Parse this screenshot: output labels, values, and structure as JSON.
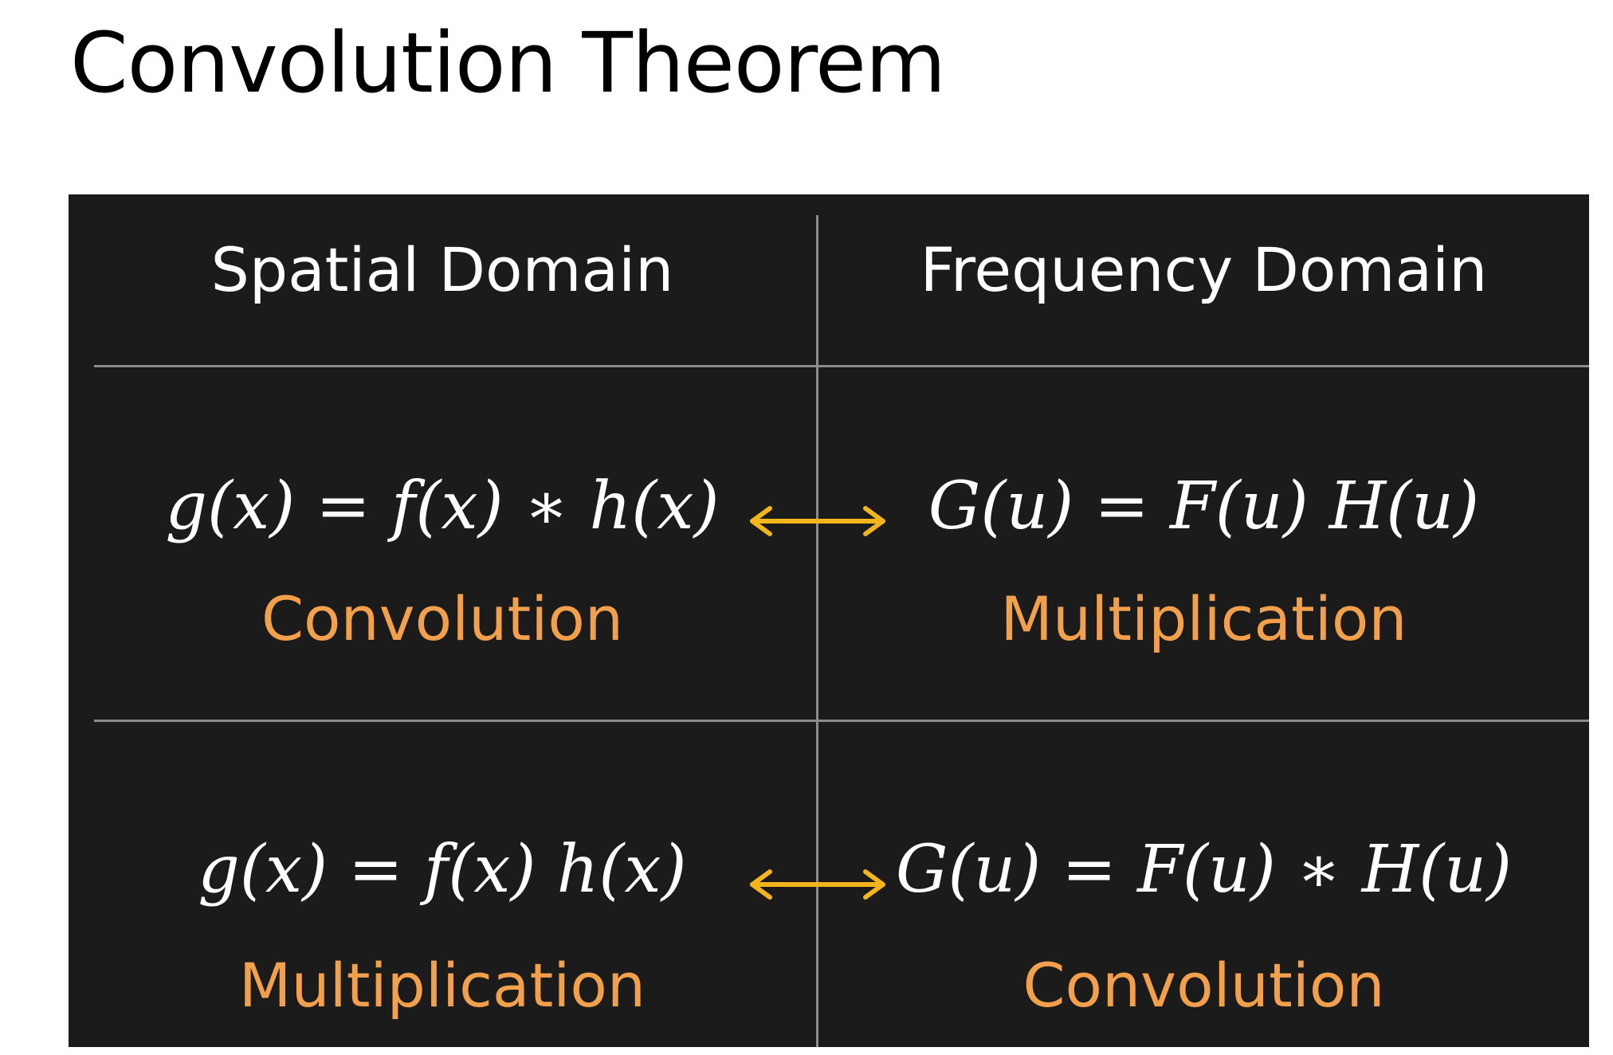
{
  "title": "Convolution Theorem",
  "headers": {
    "spatial": "Spatial Domain",
    "frequency": "Frequency Domain"
  },
  "rows": [
    {
      "spatial_equation": "g(x) = f(x) ∗ h(x)",
      "spatial_operation": "Convolution",
      "frequency_equation": "G(u) = F(u) H(u)",
      "frequency_operation": "Multiplication"
    },
    {
      "spatial_equation": "g(x) = f(x) h(x)",
      "spatial_operation": "Multiplication",
      "frequency_equation": "G(u) = F(u) ∗ H(u)",
      "frequency_operation": "Convolution"
    }
  ],
  "icons": {
    "arrow": "double-arrow-icon"
  },
  "colors": {
    "panel_background": "#1b1b1b",
    "operation_text": "#f2a04c",
    "arrow": "#f2b51c",
    "divider": "#8c8c8c"
  }
}
